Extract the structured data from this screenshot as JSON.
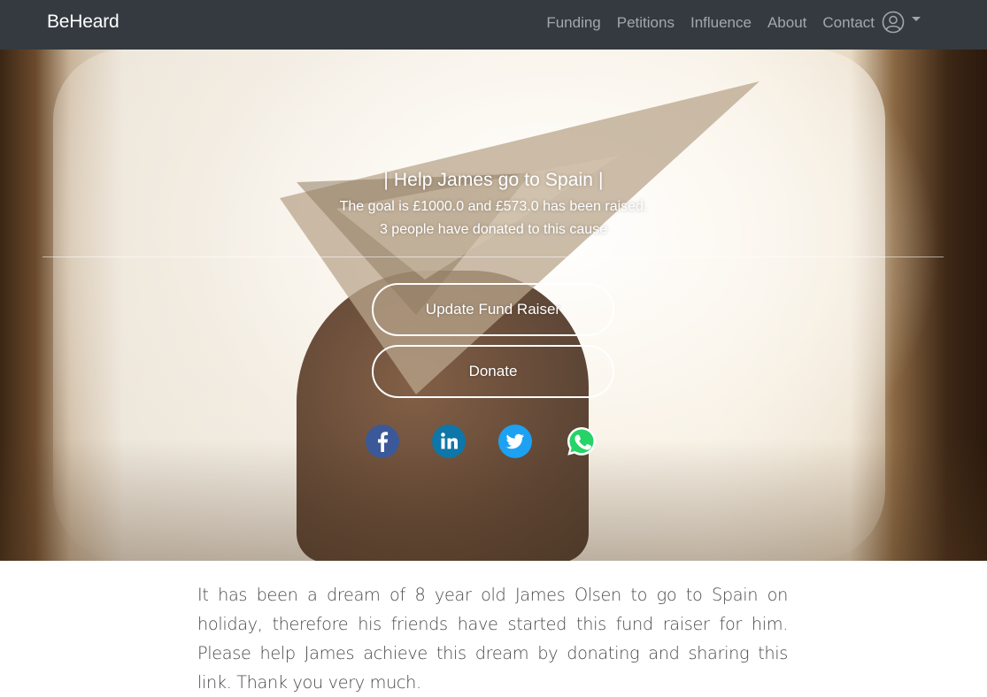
{
  "navbar": {
    "brand": "BeHeard",
    "links": [
      "Funding",
      "Petitions",
      "Influence",
      "About",
      "Contact"
    ],
    "user_icon": "user-circle-icon",
    "caret_icon": "caret-down-icon"
  },
  "hero": {
    "title": "| Help James go to Spain |",
    "goal_text": "The goal is £1000.0 and £573.0 has been raised.",
    "donors_text": "3 people have donated to this cause",
    "update_button": "Update Fund Raiser",
    "donate_button": "Donate",
    "share_icons": [
      "facebook-icon",
      "linkedin-icon",
      "twitter-icon",
      "whatsapp-icon"
    ]
  },
  "content": {
    "description": "It has been a dream of 8 year old James Olsen to go to Spain on holiday, therefore his friends have started this fund raiser for him. Please help James achieve this dream by donating and sharing this link. Thank you very much."
  },
  "colors": {
    "navbar_bg": "#343a40",
    "nav_link": "rgba(255,255,255,0.55)",
    "facebook": "#3b5998",
    "linkedin": "#0e76a8",
    "twitter": "#1da1f2",
    "whatsapp": "#25d366"
  }
}
